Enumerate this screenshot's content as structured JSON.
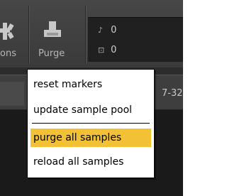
{
  "toolbar": {
    "left_label": "ons",
    "purge_label": "Purge",
    "counters": [
      {
        "glyph": "♪",
        "value": "0"
      },
      {
        "glyph": "⊡",
        "value": "0"
      }
    ]
  },
  "row2": {
    "text": "7-32"
  },
  "menu": {
    "items": [
      {
        "label": "reset markers"
      },
      {
        "label": "update sample pool"
      },
      {
        "label": "purge all samples",
        "highlighted": true
      },
      {
        "label": "reload all samples"
      }
    ],
    "colors": {
      "highlight": "#f2c135"
    }
  }
}
